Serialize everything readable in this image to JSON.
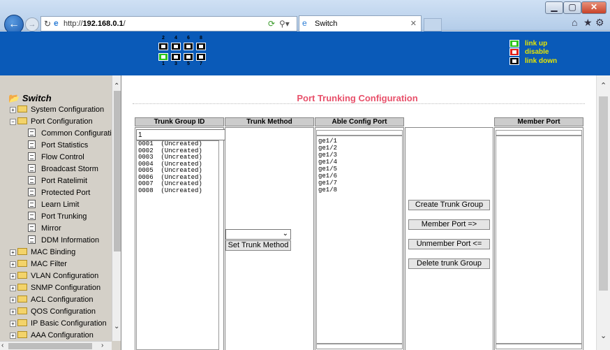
{
  "browser": {
    "url_prefix": "http://",
    "url_host": "192.168.0.1",
    "url_suffix": "/",
    "tab_title": "Switch",
    "window_buttons": {
      "minimize": "▁",
      "maximize": "▢",
      "close": "✕"
    }
  },
  "banner": {
    "top_port_numbers": [
      "2",
      "4",
      "6",
      "8"
    ],
    "bottom_port_numbers": [
      "1",
      "3",
      "5",
      "7"
    ],
    "legend": [
      {
        "label": "link up",
        "color": "#2bc41b"
      },
      {
        "label": "disable",
        "color": "#e0201a"
      },
      {
        "label": "link down",
        "color": "#000000"
      }
    ]
  },
  "sidebar": {
    "root_label": "Switch",
    "items": [
      {
        "label": "System Configuration",
        "kind": "folder",
        "expander": "+"
      },
      {
        "label": "Port Configuration",
        "kind": "folder",
        "expander": "−"
      },
      {
        "label": "Common Configuratio",
        "kind": "doc"
      },
      {
        "label": "Port Statistics",
        "kind": "doc"
      },
      {
        "label": "Flow Control",
        "kind": "doc"
      },
      {
        "label": "Broadcast Storm",
        "kind": "doc"
      },
      {
        "label": "Port Ratelimit",
        "kind": "doc"
      },
      {
        "label": "Protected Port",
        "kind": "doc"
      },
      {
        "label": "Learn Limit",
        "kind": "doc"
      },
      {
        "label": "Port Trunking",
        "kind": "doc"
      },
      {
        "label": "Mirror",
        "kind": "doc"
      },
      {
        "label": "DDM Information",
        "kind": "doc"
      },
      {
        "label": "MAC Binding",
        "kind": "folder",
        "expander": "+"
      },
      {
        "label": "MAC Filter",
        "kind": "folder",
        "expander": "+"
      },
      {
        "label": "VLAN Configuration",
        "kind": "folder",
        "expander": "+"
      },
      {
        "label": "SNMP Configuration",
        "kind": "folder",
        "expander": "+"
      },
      {
        "label": "ACL Configuration",
        "kind": "folder",
        "expander": "+"
      },
      {
        "label": "QOS Configuration",
        "kind": "folder",
        "expander": "+"
      },
      {
        "label": "IP Basic Configuration",
        "kind": "folder",
        "expander": "+"
      },
      {
        "label": "AAA Configuration",
        "kind": "folder",
        "expander": "+"
      }
    ]
  },
  "main": {
    "title": "Port Trunking Configuration",
    "columns": {
      "trunk_group_id": "Trunk Group ID",
      "trunk_method": "Trunk Method",
      "able_config_port": "Able Config Port",
      "member_port": "Member Port"
    },
    "trunk_group_input_value": "1",
    "trunk_groups": [
      "0001  (Uncreated)",
      "0002  (Uncreated)",
      "0003  (Uncreated)",
      "0004  (Uncreated)",
      "0005  (Uncreated)",
      "0006  (Uncreated)",
      "0007  (Uncreated)",
      "0008  (Uncreated)"
    ],
    "trunk_method_value": "",
    "set_trunk_method_label": "Set Trunk Method",
    "able_ports": [
      "ge1/1",
      "ge1/2",
      "ge1/3",
      "ge1/4",
      "ge1/5",
      "ge1/6",
      "ge1/7",
      "ge1/8"
    ],
    "buttons": {
      "create": "Create Trunk Group",
      "member": "Member Port =>",
      "unmember": "Unmember Port <=",
      "delete": "Delete trunk Group"
    },
    "member_ports": []
  }
}
